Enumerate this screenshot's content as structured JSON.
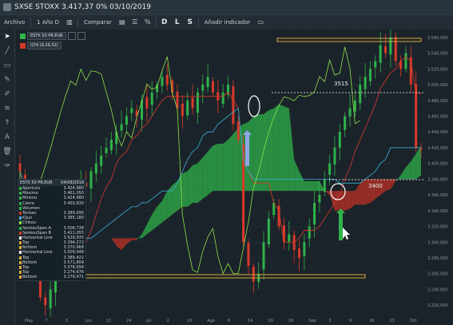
{
  "window": {
    "title": "SXSE STOXX 3.417,37 0% 03/10/2019"
  },
  "toolbar": {
    "items": [
      "Archivo",
      "1 Año D",
      "Comparar",
      "Añadir indicador"
    ],
    "icons": [
      "cursor-icon",
      "chart-type-icon",
      "percent-icon",
      "draw-D-icon",
      "draw-L-icon",
      "draw-S-icon"
    ],
    "letters": [
      "%",
      "D",
      "L",
      "S"
    ]
  },
  "legend": {
    "symbol": "ESTX 50 PR.EUR",
    "indicator": "ICHI (9,26,52)",
    "symbol_color": "#2fb34a",
    "indicator_color": "#d83a2a"
  },
  "info_panel": {
    "symbol": "ESTX 50 PR.EUR",
    "date": "04/09/2019",
    "rows": [
      {
        "label": "Apertura",
        "value": "3.424,980",
        "color": "#2fb34a"
      },
      {
        "label": "Máximo",
        "value": "3.461,050",
        "color": "#2fb34a"
      },
      {
        "label": "Mínimo",
        "value": "3.424,980",
        "color": "#2fb34a"
      },
      {
        "label": "Cierre",
        "value": "3.450,830",
        "color": "#2fb34a"
      },
      {
        "label": "Volumen",
        "value": "",
        "color": "#2fb34a"
      },
      {
        "label": "Tenkan",
        "value": "3.389,695",
        "color": "#d83a2a"
      },
      {
        "label": "Kijun",
        "value": "3.385,180",
        "color": "#3bb0d8"
      },
      {
        "label": "Chikou",
        "value": "",
        "color": "#8fe04a"
      },
      {
        "label": "SenkouSpan A",
        "value": "3.506,738",
        "color": "#2fb34a"
      },
      {
        "label": "SenkouSpan B",
        "value": "3.411,055",
        "color": "#d83a2a"
      },
      {
        "label": "Horizontal Line",
        "value": "3.529,935",
        "color": "#f0f0f0"
      },
      {
        "label": "Top",
        "value": "3.394,272",
        "color": "#d9a93a"
      },
      {
        "label": "Bottom",
        "value": "3.370,968",
        "color": "#d9a93a"
      },
      {
        "label": "Horizontal Line",
        "value": "3.509,948",
        "color": "#f0f0f0"
      },
      {
        "label": "Top",
        "value": "3.389,422",
        "color": "#d9a93a"
      },
      {
        "label": "Bottom",
        "value": "3.571,809",
        "color": "#d9a93a"
      },
      {
        "label": "Top",
        "value": "3.576,694",
        "color": "#d9a93a"
      },
      {
        "label": "Top",
        "value": "3.274,676",
        "color": "#d9a93a"
      },
      {
        "label": "Bottom",
        "value": "3.279,471",
        "color": "#d9a93a"
      }
    ]
  },
  "annotations": {
    "level_high": "3515",
    "level_low": "3400"
  },
  "chart_data": {
    "type": "candlestick",
    "price_axis": [
      "3.560,000",
      "3.540,000",
      "3.520,000",
      "3.500,000",
      "3.480,000",
      "3.460,000",
      "3.440,000",
      "3.420,000",
      "3.400,000",
      "3.380,000",
      "3.360,000",
      "3.340,000",
      "3.320,000",
      "3.300,000",
      "3.280,000",
      "3.260,000",
      "3.240,000",
      "3.220,000"
    ],
    "ylim": [
      3210,
      3570
    ],
    "date_axis": [
      "May",
      "7",
      "3",
      "Jun",
      "13",
      "24",
      "Jul",
      "2",
      "10",
      "Ago",
      "9",
      "14",
      "19",
      "26",
      "Sep",
      "3",
      "9",
      "16",
      "23",
      "Oct"
    ],
    "series_colors": {
      "up": "#2fb34a",
      "down": "#d83a2a",
      "tenkan": "#d83a2a",
      "kijun": "#3bb0d8",
      "chikou": "#8fe04a"
    },
    "closes": [
      3390,
      3350,
      3310,
      3260,
      3230,
      3220,
      3240,
      3270,
      3300,
      3320,
      3330,
      3360,
      3380,
      3370,
      3390,
      3400,
      3410,
      3420,
      3430,
      3440,
      3450,
      3460,
      3470,
      3460,
      3480,
      3470,
      3490,
      3500,
      3510,
      3500,
      3490,
      3470,
      3460,
      3480,
      3470,
      3490,
      3500,
      3510,
      3490,
      3480,
      3490,
      3500,
      3450,
      3430,
      3300,
      3270,
      3250,
      3260,
      3300,
      3330,
      3350,
      3320,
      3300,
      3310,
      3290,
      3280,
      3300,
      3320,
      3350,
      3360,
      3380,
      3400,
      3420,
      3440,
      3460,
      3470,
      3480,
      3500,
      3510,
      3520,
      3530,
      3550,
      3540,
      3560,
      3530,
      3520,
      3540,
      3500,
      3420,
      3417
    ]
  }
}
